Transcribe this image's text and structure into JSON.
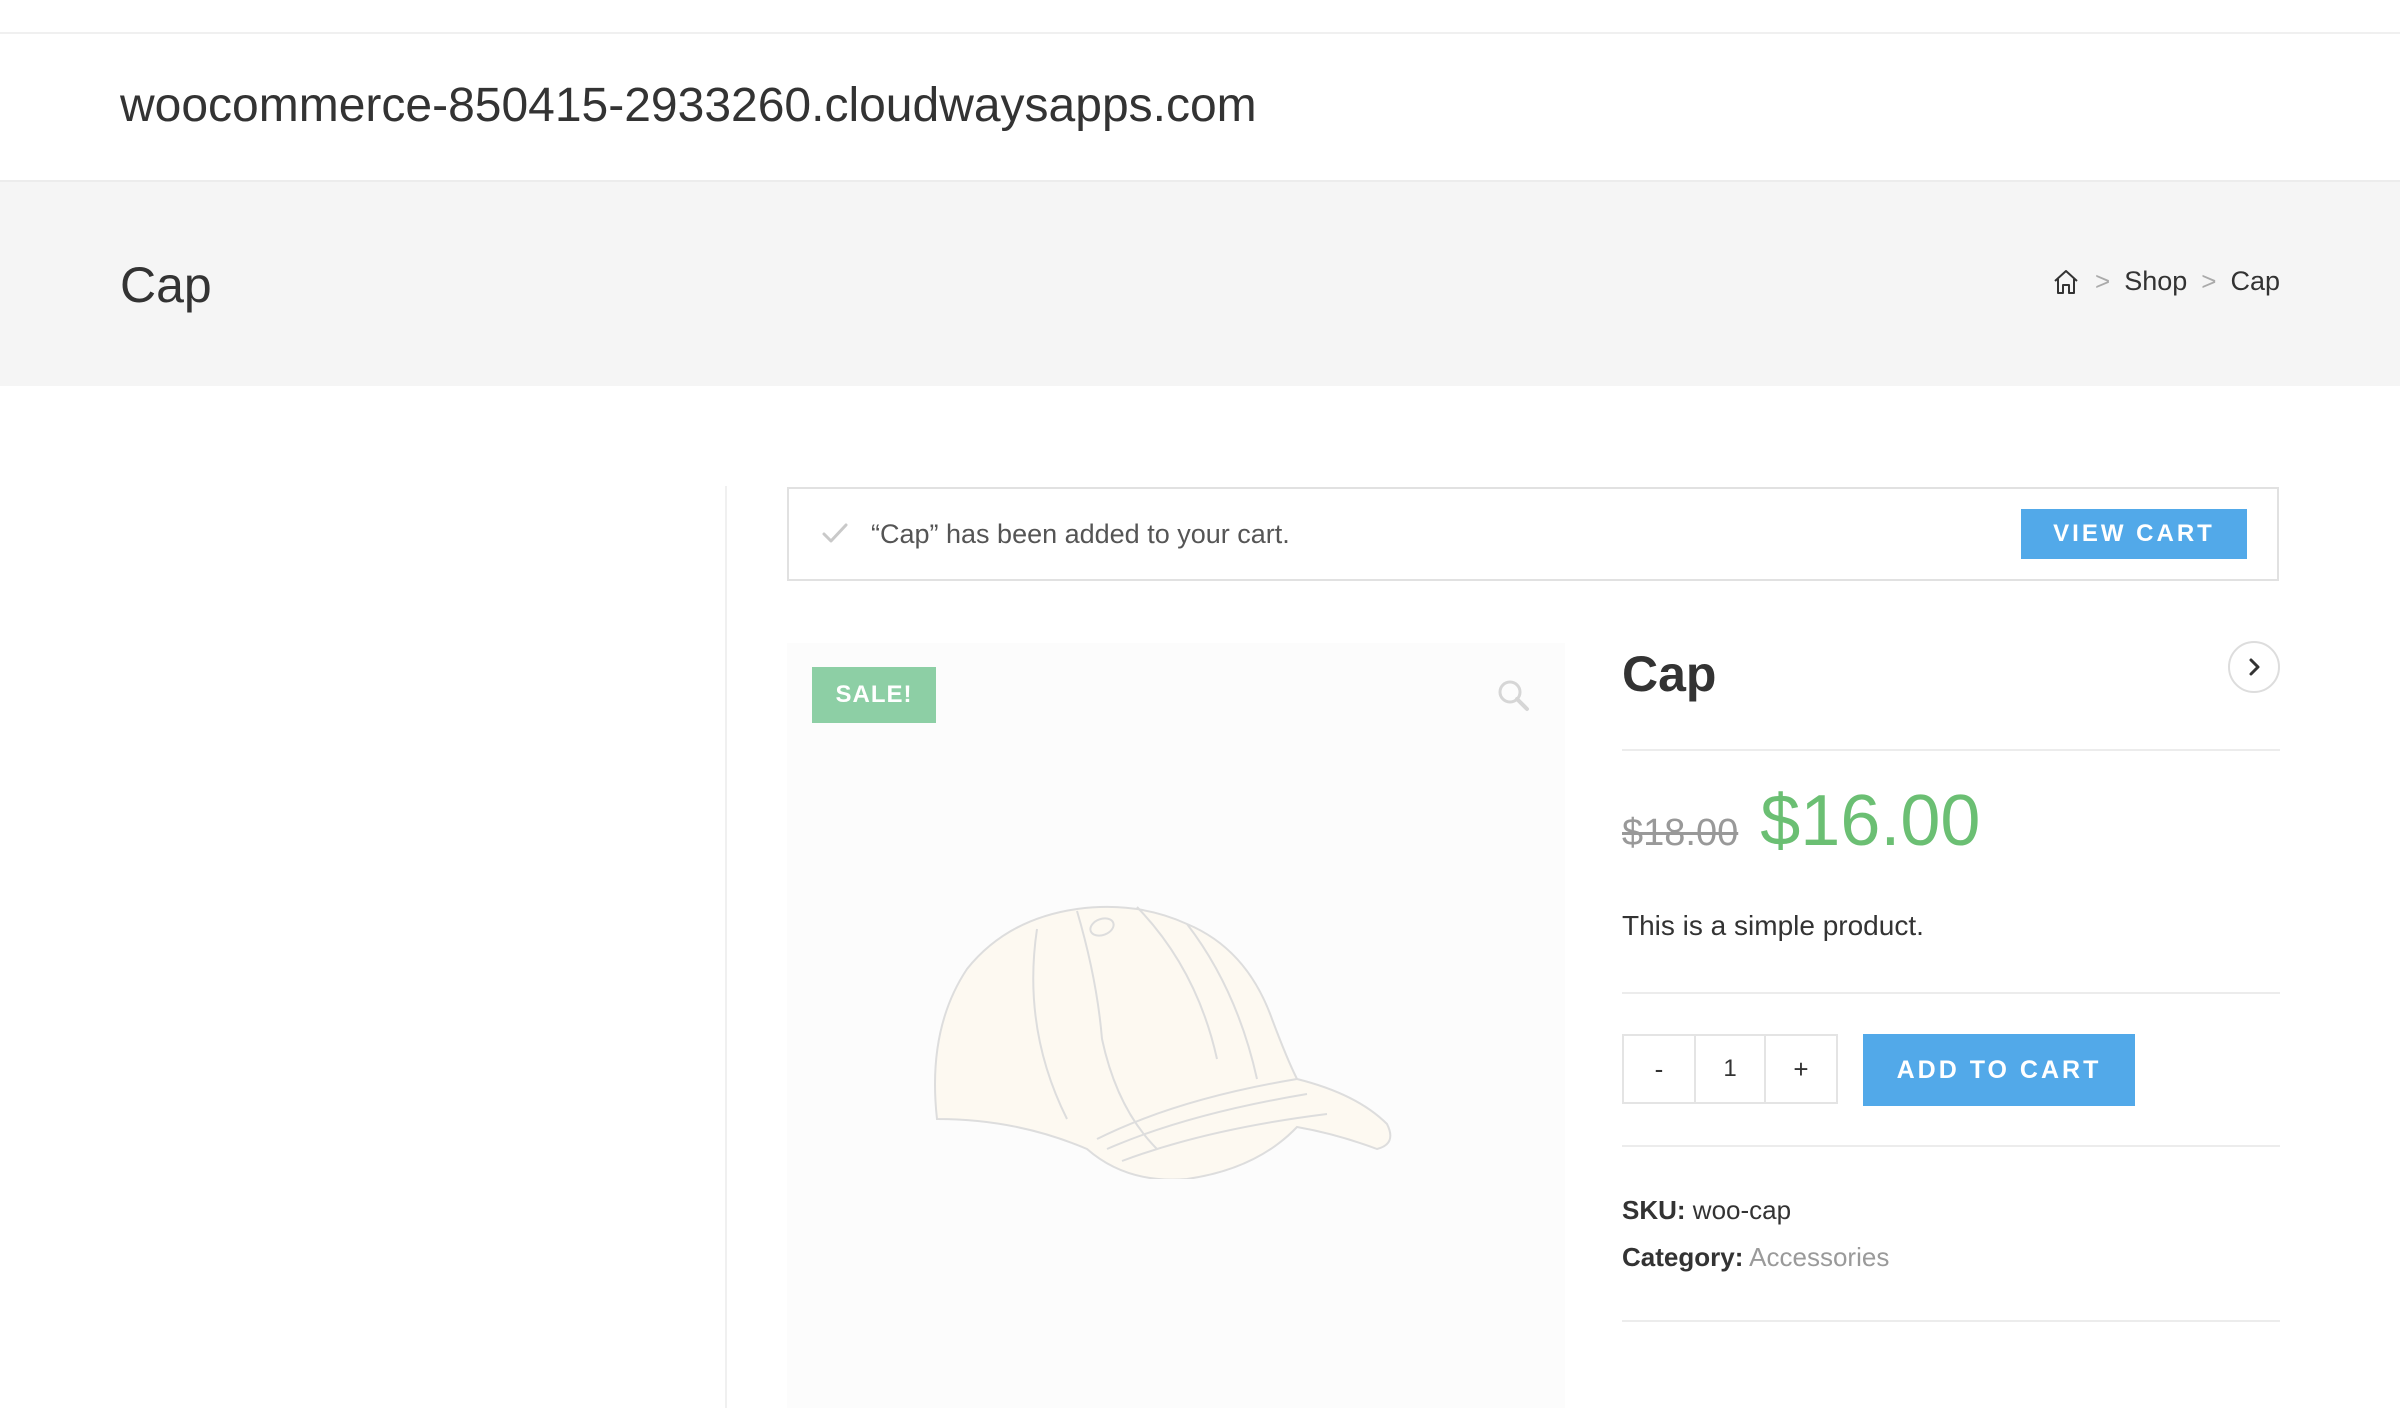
{
  "header": {
    "site_title": "woocommerce-850415-2933260.cloudwaysapps.com"
  },
  "page_header": {
    "title": "Cap",
    "breadcrumb": {
      "home_icon": "home-icon",
      "separator": ">",
      "items": [
        "Shop",
        "Cap"
      ]
    }
  },
  "notice": {
    "icon": "check-icon",
    "message": "“Cap” has been added to your cart.",
    "button_label": "VIEW CART"
  },
  "gallery": {
    "badge": "SALE!",
    "zoom_icon": "magnifier-icon",
    "image": "cap-image"
  },
  "product": {
    "title": "Cap",
    "next_icon": "chevron-right-icon",
    "price_old": "$18.00",
    "price_new": "$16.00",
    "short_description": "This is a simple product.",
    "quantity": {
      "minus": "-",
      "value": "1",
      "plus": "+"
    },
    "add_to_cart_label": "ADD TO CART",
    "meta": {
      "sku_label": "SKU:",
      "sku_value": "woo-cap",
      "category_label": "Category:",
      "category_value": "Accessories"
    }
  },
  "colors": {
    "accent_blue": "#52a9e9",
    "sale_green": "#8dcfa5",
    "price_green": "#6bbf73",
    "page_header_bg": "#f5f5f5"
  }
}
